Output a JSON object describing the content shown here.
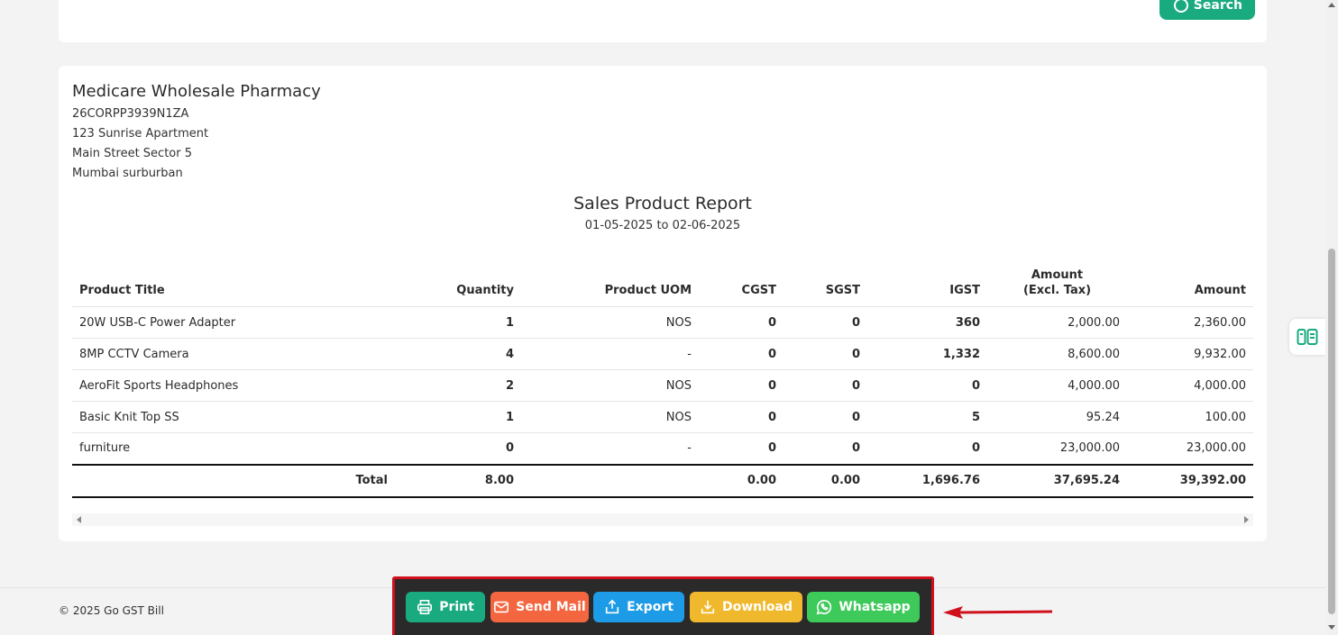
{
  "search": {
    "label": "Search"
  },
  "company": {
    "name": "Medicare Wholesale Pharmacy",
    "gstin": "26CORPP3939N1ZA",
    "address_line1": "123 Sunrise Apartment",
    "address_line2": "Main Street Sector 5",
    "address_line3": "Mumbai surburban"
  },
  "report": {
    "title": "Sales Product Report",
    "date_range": "01-05-2025 to 02-06-2025"
  },
  "table": {
    "headers": {
      "product_title": "Product Title",
      "quantity": "Quantity",
      "product_uom": "Product UOM",
      "cgst": "CGST",
      "sgst": "SGST",
      "igst": "IGST",
      "amount_excl_line1": "Amount",
      "amount_excl_line2": "(Excl. Tax)",
      "amount": "Amount"
    },
    "rows": [
      {
        "product": "20W USB-C Power Adapter",
        "qty": "1",
        "uom": "NOS",
        "cgst": "0",
        "sgst": "0",
        "igst": "360",
        "amount_excl": "2,000.00",
        "amount": "2,360.00"
      },
      {
        "product": "8MP CCTV Camera",
        "qty": "4",
        "uom": "-",
        "cgst": "0",
        "sgst": "0",
        "igst": "1,332",
        "amount_excl": "8,600.00",
        "amount": "9,932.00"
      },
      {
        "product": "AeroFit Sports Headphones",
        "qty": "2",
        "uom": "NOS",
        "cgst": "0",
        "sgst": "0",
        "igst": "0",
        "amount_excl": "4,000.00",
        "amount": "4,000.00"
      },
      {
        "product": "Basic Knit Top SS",
        "qty": "1",
        "uom": "NOS",
        "cgst": "0",
        "sgst": "0",
        "igst": "5",
        "amount_excl": "95.24",
        "amount": "100.00"
      },
      {
        "product": "furniture",
        "qty": "0",
        "uom": "-",
        "cgst": "0",
        "sgst": "0",
        "igst": "0",
        "amount_excl": "23,000.00",
        "amount": "23,000.00"
      }
    ],
    "total": {
      "label": "Total",
      "qty": "8.00",
      "cgst": "0.00",
      "sgst": "0.00",
      "igst": "1,696.76",
      "amount_excl": "37,695.24",
      "amount": "39,392.00"
    }
  },
  "footer": {
    "copyright": "© 2025 Go GST Bill"
  },
  "actions": {
    "print": "Print",
    "send_mail": "Send Mail",
    "export": "Export",
    "download": "Download",
    "whatsapp": "Whatsapp"
  },
  "colors": {
    "print": "#1aaa7f",
    "send_mail": "#f4663f",
    "export": "#1e9be6",
    "download": "#f0b82d",
    "whatsapp": "#3ec95b",
    "highlight": "#d0101c"
  },
  "icons": [
    "search-icon",
    "printer-icon",
    "mail-icon",
    "export-icon",
    "download-icon",
    "whatsapp-icon",
    "report-toggle-icon"
  ]
}
